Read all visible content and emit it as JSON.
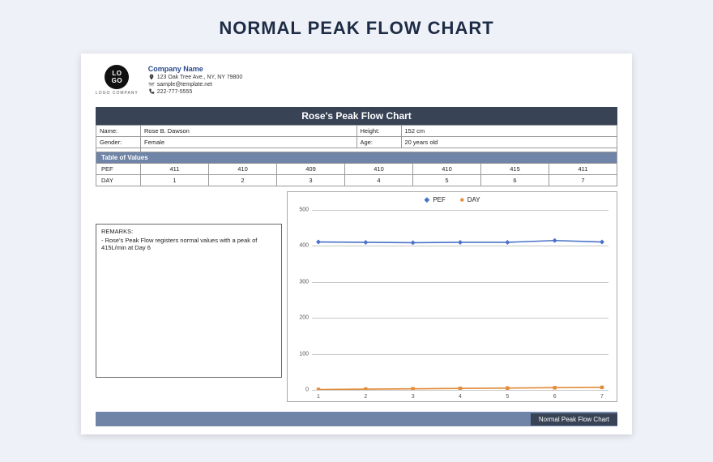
{
  "page_title": "NORMAL PEAK FLOW CHART",
  "logo": {
    "text": "LO\nGO",
    "subtext": "LOGO COMPANY"
  },
  "company": {
    "name": "Company Name",
    "address": "123 Oak Tree Ave., NY, NY 79800",
    "email": "sample@template.net",
    "phone": "222-777-5555"
  },
  "chart_title": "Rose's Peak Flow Chart",
  "info": {
    "name_label": "Name:",
    "name": "Rose B. Dawson",
    "height_label": "Height:",
    "height": "152 cm",
    "gender_label": "Gender:",
    "gender": "Female",
    "age_label": "Age:",
    "age": "20 years old"
  },
  "table_of_values_label": "Table of Values",
  "row_labels": {
    "pef": "PEF",
    "day": "DAY"
  },
  "chart_data": {
    "type": "line",
    "title": "Rose's Peak Flow Chart",
    "xlabel": "",
    "ylabel": "",
    "ylim": [
      0,
      500
    ],
    "yticks": [
      0,
      100,
      200,
      300,
      400,
      500
    ],
    "x": [
      1,
      2,
      3,
      4,
      5,
      6,
      7
    ],
    "series": [
      {
        "name": "PEF",
        "color": "#4a72c8",
        "values": [
          411,
          410,
          409,
          410,
          410,
          415,
          411
        ]
      },
      {
        "name": "DAY",
        "color": "#e28b3a",
        "values": [
          1,
          2,
          3,
          4,
          5,
          6,
          7
        ]
      }
    ],
    "legend_position": "top-center"
  },
  "remarks_label": "REMARKS:",
  "remarks_text": "- Rose's Peak Flow registers normal values with a peak of 415L/min at Day 6",
  "footer_label": "Normal Peak Flow Chart"
}
